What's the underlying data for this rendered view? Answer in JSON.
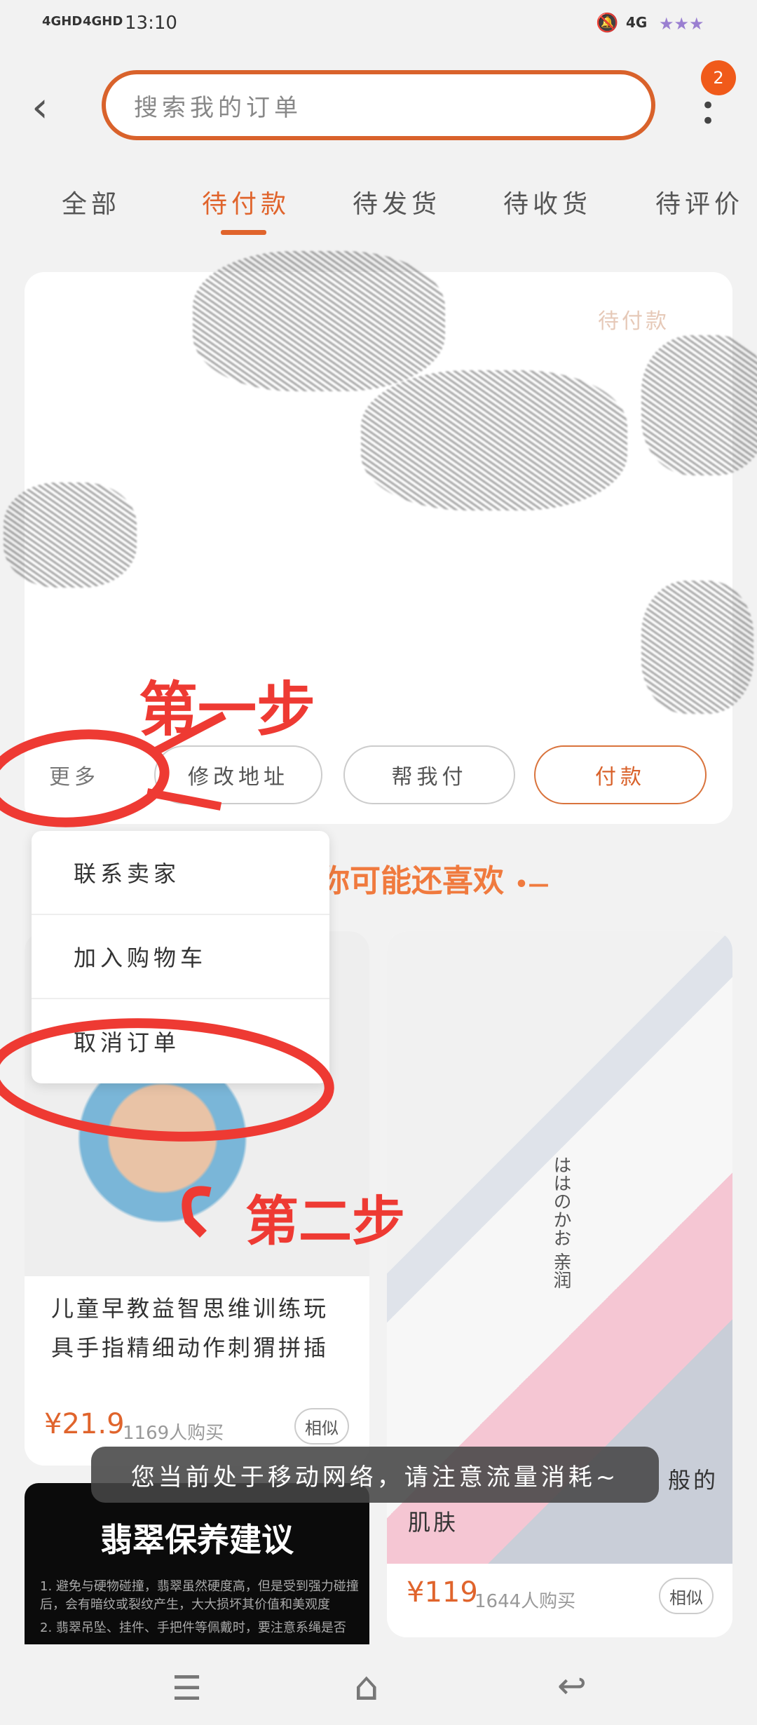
{
  "status_bar": {
    "signal1": "4GHD",
    "signal2": "4GHD",
    "time": "13:10",
    "network": "4G"
  },
  "header": {
    "search_placeholder": "搜索我的订单",
    "badge_count": "2"
  },
  "tabs": [
    {
      "label": "全部"
    },
    {
      "label": "待付款",
      "active": true
    },
    {
      "label": "待发货"
    },
    {
      "label": "待收货"
    },
    {
      "label": "待评价"
    }
  ],
  "order": {
    "status": "待付款",
    "buttons": {
      "more": "更多",
      "modify_address": "修改地址",
      "help_pay": "帮我付",
      "pay": "付款"
    }
  },
  "annotations": {
    "step1": "第一步",
    "step2": "第二步"
  },
  "more_menu": [
    {
      "label": "联系卖家"
    },
    {
      "label": "加入购物车"
    },
    {
      "label": "取消订单"
    }
  ],
  "recommend": {
    "heading": "你可能还喜欢"
  },
  "products": [
    {
      "title": "儿童早教益智思维训练玩具手指精细动作刺猬拼插",
      "price": "¥21.9",
      "sold": "1169人购买",
      "similar": "相似"
    },
    {
      "title_visible_end": "般的",
      "title_line2": "肌肤",
      "price": "¥119",
      "sold": "1644人购买",
      "similar": "相似",
      "image_text": "ははのかお 亲润"
    },
    {
      "banner_title": "翡翠保养建议",
      "banner_lines": [
        "1. 避免与硬物碰撞，翡翠虽然硬度高，但是受到强力碰撞后，会有暗纹或裂纹产生，大大损坏其价值和美观度",
        "2. 翡翠吊坠、挂件、手把件等佩戴时，要注意系绳是否"
      ]
    }
  ],
  "toast": "您当前处于移动网络，请注意流量消耗~",
  "colors": {
    "accent": "#e0642c",
    "annotation": "#ee3a33"
  }
}
